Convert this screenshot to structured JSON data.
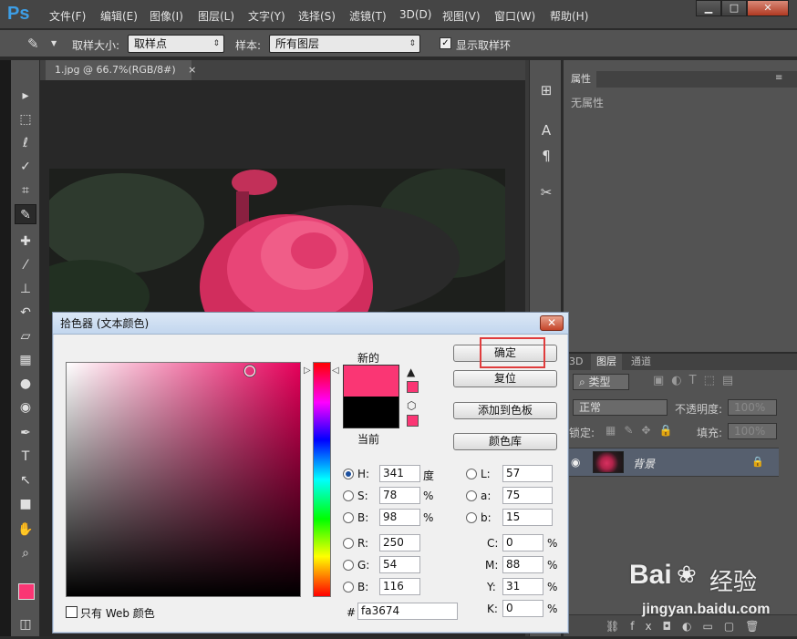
{
  "app": {
    "logo": "Ps"
  },
  "menu": [
    "文件(F)",
    "编辑(E)",
    "图像(I)",
    "图层(L)",
    "文字(Y)",
    "选择(S)",
    "滤镜(T)",
    "3D(D)",
    "视图(V)",
    "窗口(W)",
    "帮助(H)"
  ],
  "window_controls": {
    "minimize": "▁",
    "maximize": "□",
    "close": "✕"
  },
  "options": {
    "sample_size_label": "取样大小:",
    "sample_size_value": "取样点",
    "sample_label": "样本:",
    "sample_value": "所有图层",
    "show_ring_label": "显示取样环"
  },
  "document": {
    "tab_title": "1.jpg @ 66.7%(RGB/8#)",
    "close": "×"
  },
  "properties": {
    "tab": "属性",
    "empty": "无属性"
  },
  "layers_panel": {
    "tabs": [
      "3D",
      "图层",
      "通道"
    ],
    "filter_kind": "类型",
    "blend_mode": "正常",
    "opacity_label": "不透明度:",
    "opacity_value": "100%",
    "lock_label": "锁定:",
    "fill_label": "填充:",
    "fill_value": "100%",
    "layer_name": "背景"
  },
  "color_picker": {
    "title": "拾色器 (文本颜色)",
    "new_label": "新的",
    "current_label": "当前",
    "new_color": "#fa3674",
    "current_color": "#000000",
    "buttons": {
      "ok": "确定",
      "reset": "复位",
      "add_swatch": "添加到色板",
      "libraries": "颜色库"
    },
    "hsb": {
      "h_label": "H:",
      "h": "341",
      "h_unit": "度",
      "s_label": "S:",
      "s": "78",
      "s_unit": "%",
      "b_label": "B:",
      "b": "98",
      "b_unit": "%"
    },
    "rgb": {
      "r_label": "R:",
      "r": "250",
      "g_label": "G:",
      "g": "54",
      "b_label": "B:",
      "b": "116"
    },
    "lab": {
      "l_label": "L:",
      "l": "57",
      "a_label": "a:",
      "a": "75",
      "b_label": "b:",
      "b": "15"
    },
    "cmyk": {
      "c_label": "C:",
      "c": "0",
      "m_label": "M:",
      "m": "88",
      "y_label": "Y:",
      "y": "31",
      "k_label": "K:",
      "k": "0",
      "unit": "%"
    },
    "hex_label": "#",
    "hex": "fa3674",
    "web_only_label": "只有 Web 颜色"
  },
  "watermark": {
    "brand": "Bai",
    "brand2": "经验",
    "url": "jingyan.baidu.com"
  },
  "colors": {
    "accent": "#3d9ee6",
    "highlight": "#e03c3c",
    "foreground_swatch": "#fa3674"
  }
}
